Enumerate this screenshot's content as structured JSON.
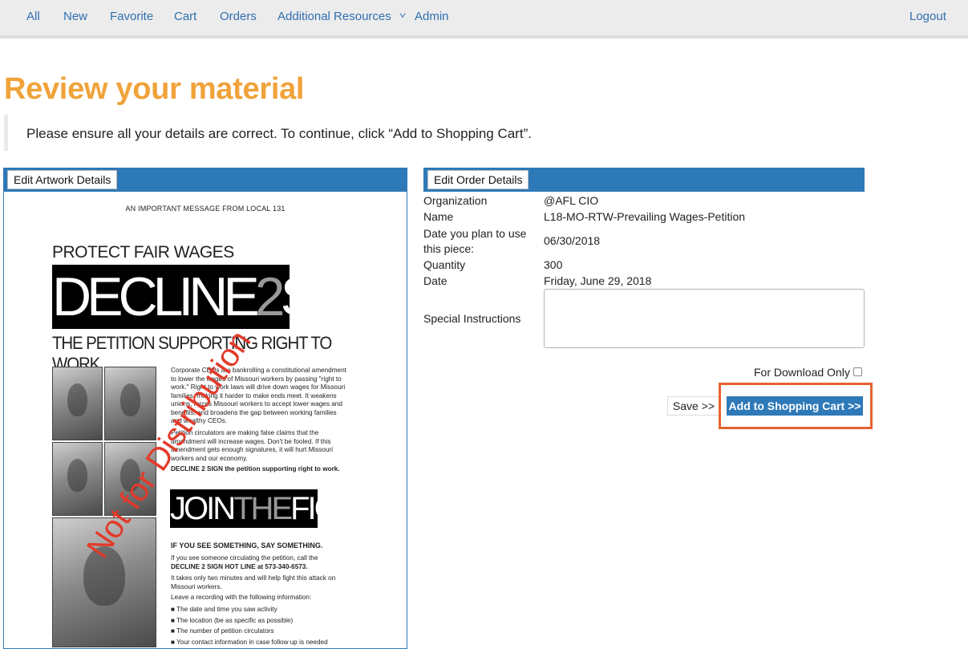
{
  "nav": {
    "items": [
      "All",
      "New",
      "Favorite",
      "Cart",
      "Orders",
      "Additional Resources",
      "Admin"
    ],
    "logout": "Logout"
  },
  "page": {
    "title": "Review your material",
    "notice": "Please ensure all your details are correct. To continue, click “Add to Shopping Cart”."
  },
  "artwork": {
    "edit_button": "Edit Artwork Details",
    "flyer": {
      "header": "AN IMPORTANT MESSAGE FROM LOCAL 131",
      "headline": "PROTECT FAIR WAGES",
      "decline_a": "DECLINE",
      "decline_2": "2",
      "decline_b": "SIGN",
      "petition": "THE PETITION SUPPORTING RIGHT TO WORK",
      "para1": "Corporate CEOs are bankrolling a constitutional amendment to lower the wages of Missouri workers by passing \"right to work.\" Right to work laws will drive down wages for Missouri families, making it harder to make ends meet. It weakens unions, forces Missouri workers to accept lower wages and benefits, and broadens the gap between working families and wealthy CEOs.",
      "para2": "Petition circulators are making false claims that the amendment will increase wages. Don't be fooled. If this amendment gets enough signatures, it will hurt Missouri workers and our economy.",
      "para3": "DECLINE 2 SIGN the petition supporting right to work.",
      "join_a": "JOIN",
      "join_the": "THE",
      "join_b": "FIGHT",
      "see_something": "IF YOU SEE SOMETHING, SAY SOMETHING.",
      "hotline_intro": "If you see someone circulating the petition, call the",
      "hotline": "DECLINE 2 SIGN HOT LINE at 573-340-6573.",
      "two_minutes": "It takes only two minutes and will help fight this attack on Missouri workers.",
      "recording": "Leave a recording with the following information:",
      "bullets": [
        "The date and time you saw activity",
        "The location (be as specific as possible)",
        "The number of petition circulators",
        "Your contact information in case follow up is needed"
      ]
    },
    "watermark": "Not for Distribution"
  },
  "order": {
    "edit_button": "Edit Order Details",
    "fields": [
      {
        "label": "Organization",
        "value": "@AFL CIO"
      },
      {
        "label": "Name",
        "value": "L18-MO-RTW-Prevailing Wages-Petition"
      },
      {
        "label": "Date you plan to use this piece:",
        "value": "06/30/2018"
      },
      {
        "label": "Quantity",
        "value": "300"
      },
      {
        "label": "Date",
        "value": "Friday, June 29, 2018"
      }
    ],
    "special_label": "Special Instructions",
    "special_value": "",
    "download_label": "For Download Only",
    "download_checked": false,
    "save_label": "Save >>",
    "cart_label": "Add to Shopping Cart >>"
  },
  "colors": {
    "accent": "#2e79b8",
    "title": "#f0a33a",
    "highlight": "#e8622e",
    "watermark": "#e23a2a",
    "link": "#2f6fb0"
  }
}
